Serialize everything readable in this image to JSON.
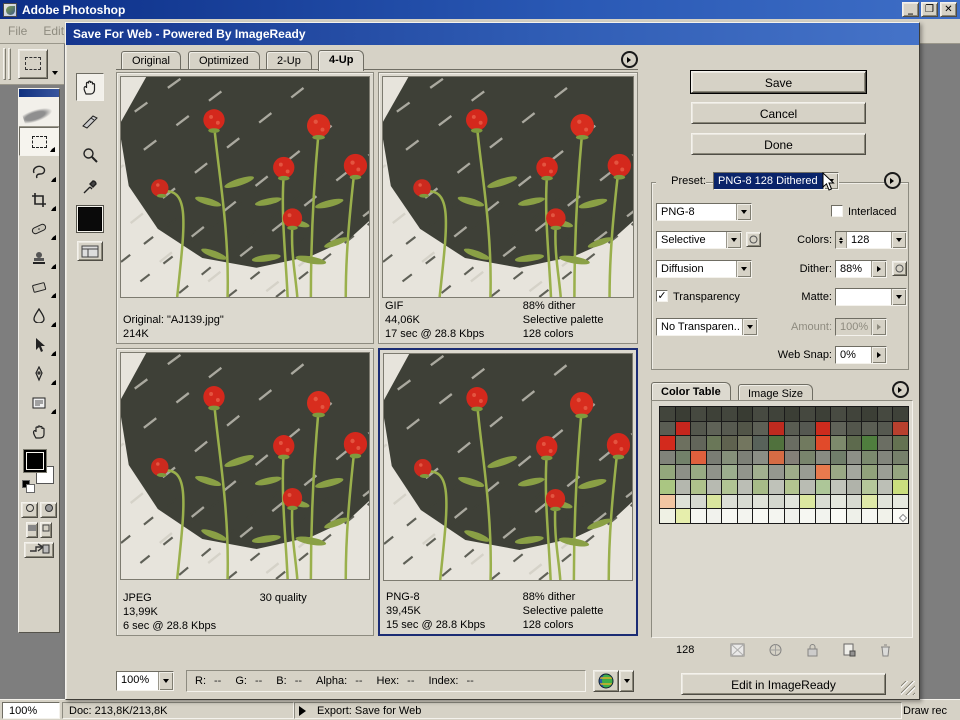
{
  "app": {
    "title": "Adobe Photoshop",
    "menus": [
      "File",
      "Edit"
    ],
    "window_buttons": [
      "minimize",
      "restore",
      "close"
    ],
    "status": {
      "zoom": "100%",
      "doc": "Doc: 213,8K/213,8K",
      "export": "Export: Save for Web",
      "hint": "Draw rec"
    }
  },
  "dialog": {
    "title": "Save For Web - Powered By ImageReady",
    "tabs": [
      {
        "label": "Original",
        "active": false
      },
      {
        "label": "Optimized",
        "active": false
      },
      {
        "label": "2-Up",
        "active": false
      },
      {
        "label": "4-Up",
        "active": true
      }
    ],
    "panels": [
      {
        "name": "original",
        "selected": false,
        "left_lines": [
          "Original: \"AJ139.jpg\"",
          "214K"
        ],
        "right_lines": []
      },
      {
        "name": "gif",
        "selected": false,
        "left_lines": [
          "GIF",
          "44,06K",
          "17 sec @ 28.8 Kbps"
        ],
        "right_lines": [
          "88% dither",
          "Selective palette",
          "128 colors"
        ]
      },
      {
        "name": "jpeg",
        "selected": false,
        "left_lines": [
          "JPEG",
          "13,99K",
          "6 sec @ 28.8 Kbps"
        ],
        "right_lines": [
          "30 quality"
        ]
      },
      {
        "name": "png8",
        "selected": true,
        "left_lines": [
          "PNG-8",
          "39,45K",
          "15 sec @ 28.8 Kbps"
        ],
        "right_lines": [
          "88% dither",
          "Selective palette",
          "128 colors"
        ]
      }
    ],
    "buttons": {
      "save": "Save",
      "cancel": "Cancel",
      "done": "Done",
      "edit_in_imageready": "Edit in ImageReady"
    },
    "preset": {
      "label": "Preset:",
      "value": "PNG-8 128 Dithered"
    },
    "settings": {
      "format": "PNG-8",
      "palette": "Selective",
      "dither_method": "Diffusion",
      "transparency_label": "Transparency",
      "transparency_checked": true,
      "matte_dropdown": "No Transparen..",
      "interlaced_label": "Interlaced",
      "interlaced_checked": false,
      "colors_label": "Colors:",
      "colors_value": "128",
      "dither_label": "Dither:",
      "dither_value": "88%",
      "matte_label": "Matte:",
      "matte_value": "",
      "amount_label": "Amount:",
      "amount_value": "100%",
      "websnap_label": "Web Snap:",
      "websnap_value": "0%"
    },
    "color_table": {
      "tab_color_table": "Color Table",
      "tab_image_size": "Image Size",
      "count": "128",
      "transparency_index": 127,
      "rows": [
        [
          "#42453c",
          "#3a3d34",
          "#464940",
          "#3e4138",
          "#43463d",
          "#393c33",
          "#474a41",
          "#40433a",
          "#3b3e35",
          "#45483f",
          "#3d4037",
          "#484b42",
          "#41443b",
          "#3c3f36",
          "#464940",
          "#3f4239"
        ],
        [
          "#5a5d53",
          "#c6261d",
          "#54574d",
          "#5f6257",
          "#575a50",
          "#525548",
          "#5d6056",
          "#bf2a1f",
          "#595c52",
          "#555851",
          "#cd2b1d",
          "#606359",
          "#53564c",
          "#5b5e54",
          "#565950",
          "#b8402e"
        ],
        [
          "#d32a1d",
          "#6d705f",
          "#62655a",
          "#6a7758",
          "#5f624f",
          "#73765f",
          "#58625a",
          "#50713d",
          "#6a6d62",
          "#717a5f",
          "#e14a2a",
          "#7d8a6c",
          "#5d6a4d",
          "#4f7e3e",
          "#6b6e63",
          "#647251"
        ],
        [
          "#80837a",
          "#72816a",
          "#e0603d",
          "#7a7d74",
          "#85907a",
          "#7d8077",
          "#8b8e85",
          "#d66b44",
          "#848078",
          "#78846c",
          "#888b82",
          "#707e6a",
          "#8d9087",
          "#7b8a6e",
          "#82857c",
          "#76806b"
        ],
        [
          "#93a77c",
          "#8d9087",
          "#98ab83",
          "#90938a",
          "#9cae8e",
          "#92958c",
          "#a2b08f",
          "#95988f",
          "#9eac89",
          "#999c93",
          "#e87a4e",
          "#9aa985",
          "#a4a79e",
          "#91a27b",
          "#9b9e95",
          "#95a580"
        ],
        [
          "#aac682",
          "#b4b7ae",
          "#afc28b",
          "#b7bab1",
          "#b1c494",
          "#bbbeb5",
          "#a7bb88",
          "#bfc2b9",
          "#b3c590",
          "#b9bcb3",
          "#adc698",
          "#c1c4bb",
          "#b0b3aa",
          "#b5c79a",
          "#bcbfb6",
          "#cade7e"
        ],
        [
          "#f2c5a2",
          "#dee1d8",
          "#d6d9d0",
          "#dae69e",
          "#dcdfd6",
          "#d8dbd2",
          "#e0e3da",
          "#d4d7ce",
          "#e2e5dc",
          "#dce8a0",
          "#d9dcd3",
          "#e4e7de",
          "#d7dad1",
          "#dfe9a8",
          "#e1e4db",
          "#e6e9e0"
        ],
        [
          "#eff1e4",
          "#e6eeac",
          "#f5f6f1",
          "#f1f2ed",
          "#f7f8f3",
          "#f3f4ef",
          "#f8f9f4",
          "#f4f5f0",
          "#f0f1ec",
          "#f6f7f2",
          "#f2f3ee",
          "#f9faf5",
          "#eef0e9",
          "#f5f6f1",
          "#f1f2ea",
          "#fbfbf6"
        ]
      ],
      "footer_icons": [
        "map-transparency-icon",
        "web-shift-icon",
        "lock-color-icon",
        "new-color-icon",
        "delete-color-icon"
      ]
    },
    "bottom": {
      "zoom": "100%",
      "info": [
        {
          "label": "R:",
          "value": "--"
        },
        {
          "label": "G:",
          "value": "--"
        },
        {
          "label": "B:",
          "value": "--"
        },
        {
          "label": "Alpha:",
          "value": "--"
        },
        {
          "label": "Hex:",
          "value": "--"
        },
        {
          "label": "Index:",
          "value": "--"
        }
      ]
    }
  },
  "colors": {
    "chrome": "#d6d2c6",
    "selection": "#0a246a",
    "app_title": "#16368e",
    "selected_panel_border": "#1b2c74"
  }
}
